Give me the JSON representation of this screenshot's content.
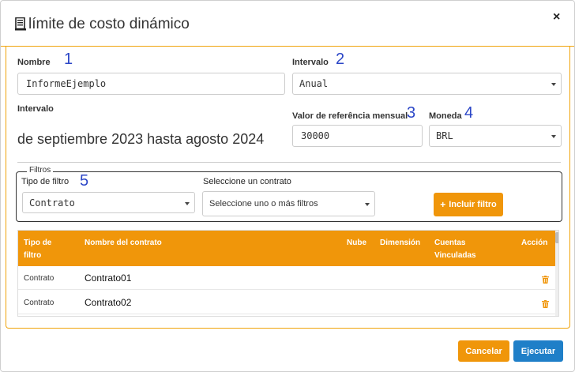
{
  "header": {
    "title": "límite de costo dinámico",
    "close_label": "×"
  },
  "form": {
    "name_label": "Nombre",
    "name_value": "InformeEjemplo",
    "interval_label": "Intervalo",
    "interval_value": "Anual",
    "period_label": "Intervalo",
    "period_text": "de septiembre 2023 hasta agosto 2024",
    "reference_label": "Valor de referência mensual",
    "reference_value": "30000",
    "currency_label": "Moneda",
    "currency_value": "BRL"
  },
  "markers": {
    "m1": "1",
    "m2": "2",
    "m3": "3",
    "m4": "4",
    "m5": "5"
  },
  "filters": {
    "legend": "Filtros",
    "type_label": "Tipo de filtro",
    "type_value": "Contrato",
    "contract_label": "Seleccione un contrato",
    "contract_placeholder": "Seleccione uno o más filtros",
    "add_button": "Incluir filtro",
    "add_icon": "+"
  },
  "table": {
    "headers": {
      "type": "Tipo de filtro",
      "name": "Nombre del contrato",
      "cloud": "Nube",
      "dimension": "Dimensión",
      "accounts": "Cuentas Vinculadas",
      "action": "Acción"
    },
    "rows": [
      {
        "type": "Contrato",
        "name": "Contrato01"
      },
      {
        "type": "Contrato",
        "name": "Contrato02"
      }
    ]
  },
  "footer": {
    "cancel": "Cancelar",
    "run": "Ejecutar"
  },
  "colors": {
    "accent": "#f0960a",
    "primary": "#1f7fc8",
    "marker": "#2b46c7"
  }
}
